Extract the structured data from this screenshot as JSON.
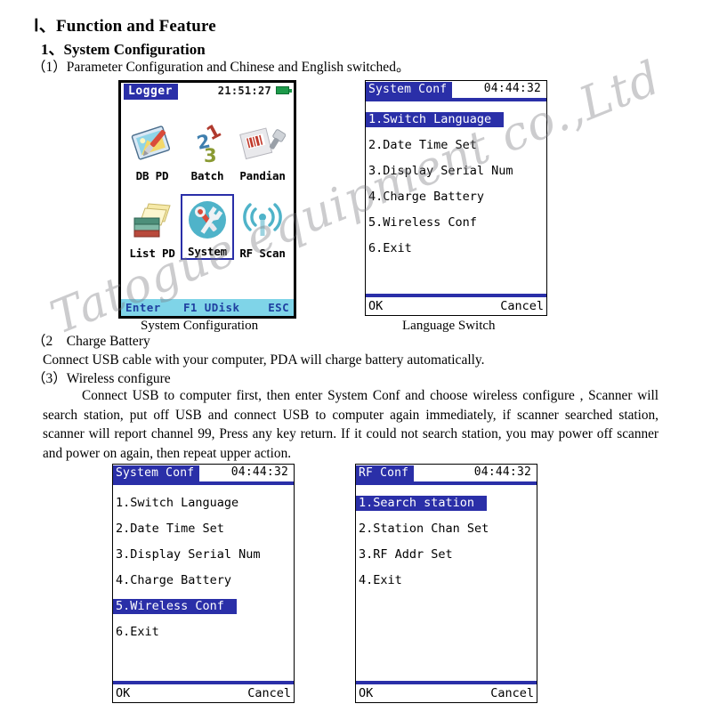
{
  "document": {
    "heading1": "Ⅰ、Function and Feature",
    "heading2": "1、System Configuration",
    "item1": "（1）Parameter Configuration and Chinese and English switched。",
    "charge_heading": "（2　Charge Battery",
    "charge_body": "Connect USB cable with your computer, PDA will charge battery automatically.",
    "wireless_heading": "（3）Wireless configure",
    "wireless_body": "Connect USB to computer first, then enter System Conf and choose wireless configure , Scanner will search station, put off USB and connect USB to computer again immediately, if scanner searched station, scanner will report channel 99, Press any key return. If it could not search station, you may power off scanner and power on again, then repeat upper action.",
    "caption_left": "System Configuration",
    "caption_right": "Language Switch",
    "watermark": "Tatogue equipment co.,Ltd"
  },
  "colors": {
    "menu_blue": "#2a2fa8",
    "footer_cyan": "#7fd4e8",
    "footer_text": "#1f3fa0",
    "battery_green": "#1d9a4a"
  },
  "logger_screen": {
    "title": "Logger",
    "clock": "21:51:27",
    "battery_icon": "battery-full-icon",
    "icons": [
      {
        "label": "DB PD",
        "icon": "db-pd-icon"
      },
      {
        "label": "Batch",
        "icon": "batch-123-icon"
      },
      {
        "label": "Pandian",
        "icon": "pandian-scanner-icon"
      },
      {
        "label": "List PD",
        "icon": "list-pd-books-icon"
      },
      {
        "label": "System",
        "icon": "system-tools-icon",
        "selected": true
      },
      {
        "label": "RF Scan",
        "icon": "rf-signal-icon"
      }
    ],
    "footer": {
      "left": "Enter",
      "middle": "F1 UDisk",
      "right": "ESC"
    }
  },
  "sysconf_screen_top": {
    "title": "System Conf",
    "clock": "04:44:32",
    "items": [
      {
        "label": "1.Switch Language",
        "selected": true
      },
      {
        "label": "2.Date Time Set",
        "selected": false
      },
      {
        "label": "3.Display Serial Num",
        "selected": false
      },
      {
        "label": "4.Charge Battery",
        "selected": false
      },
      {
        "label": "5.Wireless Conf",
        "selected": false
      },
      {
        "label": "6.Exit",
        "selected": false
      }
    ],
    "footer": {
      "ok": "OK",
      "cancel": "Cancel"
    }
  },
  "sysconf_screen_bottom": {
    "title": "System Conf",
    "clock": "04:44:32",
    "items": [
      {
        "label": "1.Switch Language",
        "selected": false
      },
      {
        "label": "2.Date Time Set",
        "selected": false
      },
      {
        "label": "3.Display Serial Num",
        "selected": false
      },
      {
        "label": "4.Charge Battery",
        "selected": false
      },
      {
        "label": "5.Wireless Conf",
        "selected": true
      },
      {
        "label": "6.Exit",
        "selected": false
      }
    ],
    "footer": {
      "ok": "OK",
      "cancel": "Cancel"
    }
  },
  "rfconf_screen": {
    "title": "RF Conf",
    "clock": "04:44:32",
    "items": [
      {
        "label": "1.Search station",
        "selected": true
      },
      {
        "label": "2.Station Chan Set",
        "selected": false
      },
      {
        "label": "3.RF Addr Set",
        "selected": false
      },
      {
        "label": "4.Exit",
        "selected": false
      }
    ],
    "footer": {
      "ok": "OK",
      "cancel": "Cancel"
    }
  }
}
